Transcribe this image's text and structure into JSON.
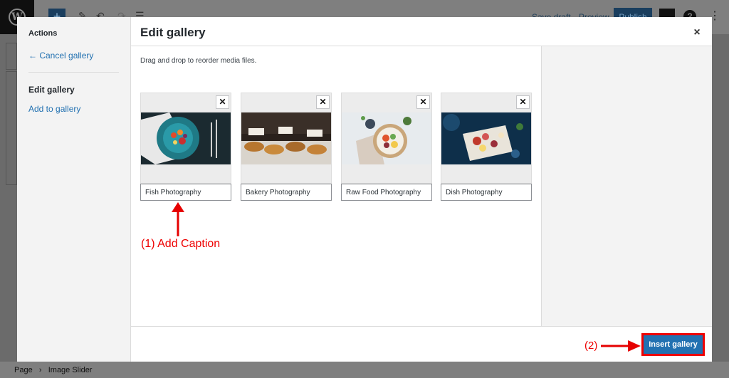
{
  "background": {
    "toolbar": {
      "save_draft": "Save draft",
      "preview": "Preview",
      "publish": "Publish"
    },
    "breadcrumb": {
      "page": "Page",
      "separator": "›",
      "block": "Image Slider"
    }
  },
  "modal": {
    "title": "Edit gallery",
    "close_glyph": "×",
    "sidebar": {
      "heading": "Actions",
      "cancel": "← Cancel gallery",
      "edit": "Edit gallery",
      "add": "Add to gallery"
    },
    "hint": "Drag and drop to reorder media files.",
    "images": [
      {
        "caption": "Fish Photography"
      },
      {
        "caption": "Bakery Photography"
      },
      {
        "caption": "Raw Food Photography"
      },
      {
        "caption": "Dish Photography"
      }
    ],
    "remove_glyph": "✕",
    "insert_button": "Insert gallery"
  },
  "annotations": {
    "step1": "(1) Add Caption",
    "step2": "(2)",
    "color": "#e60000"
  },
  "colors": {
    "accent": "#2271b1",
    "annotation": "#e60000"
  }
}
